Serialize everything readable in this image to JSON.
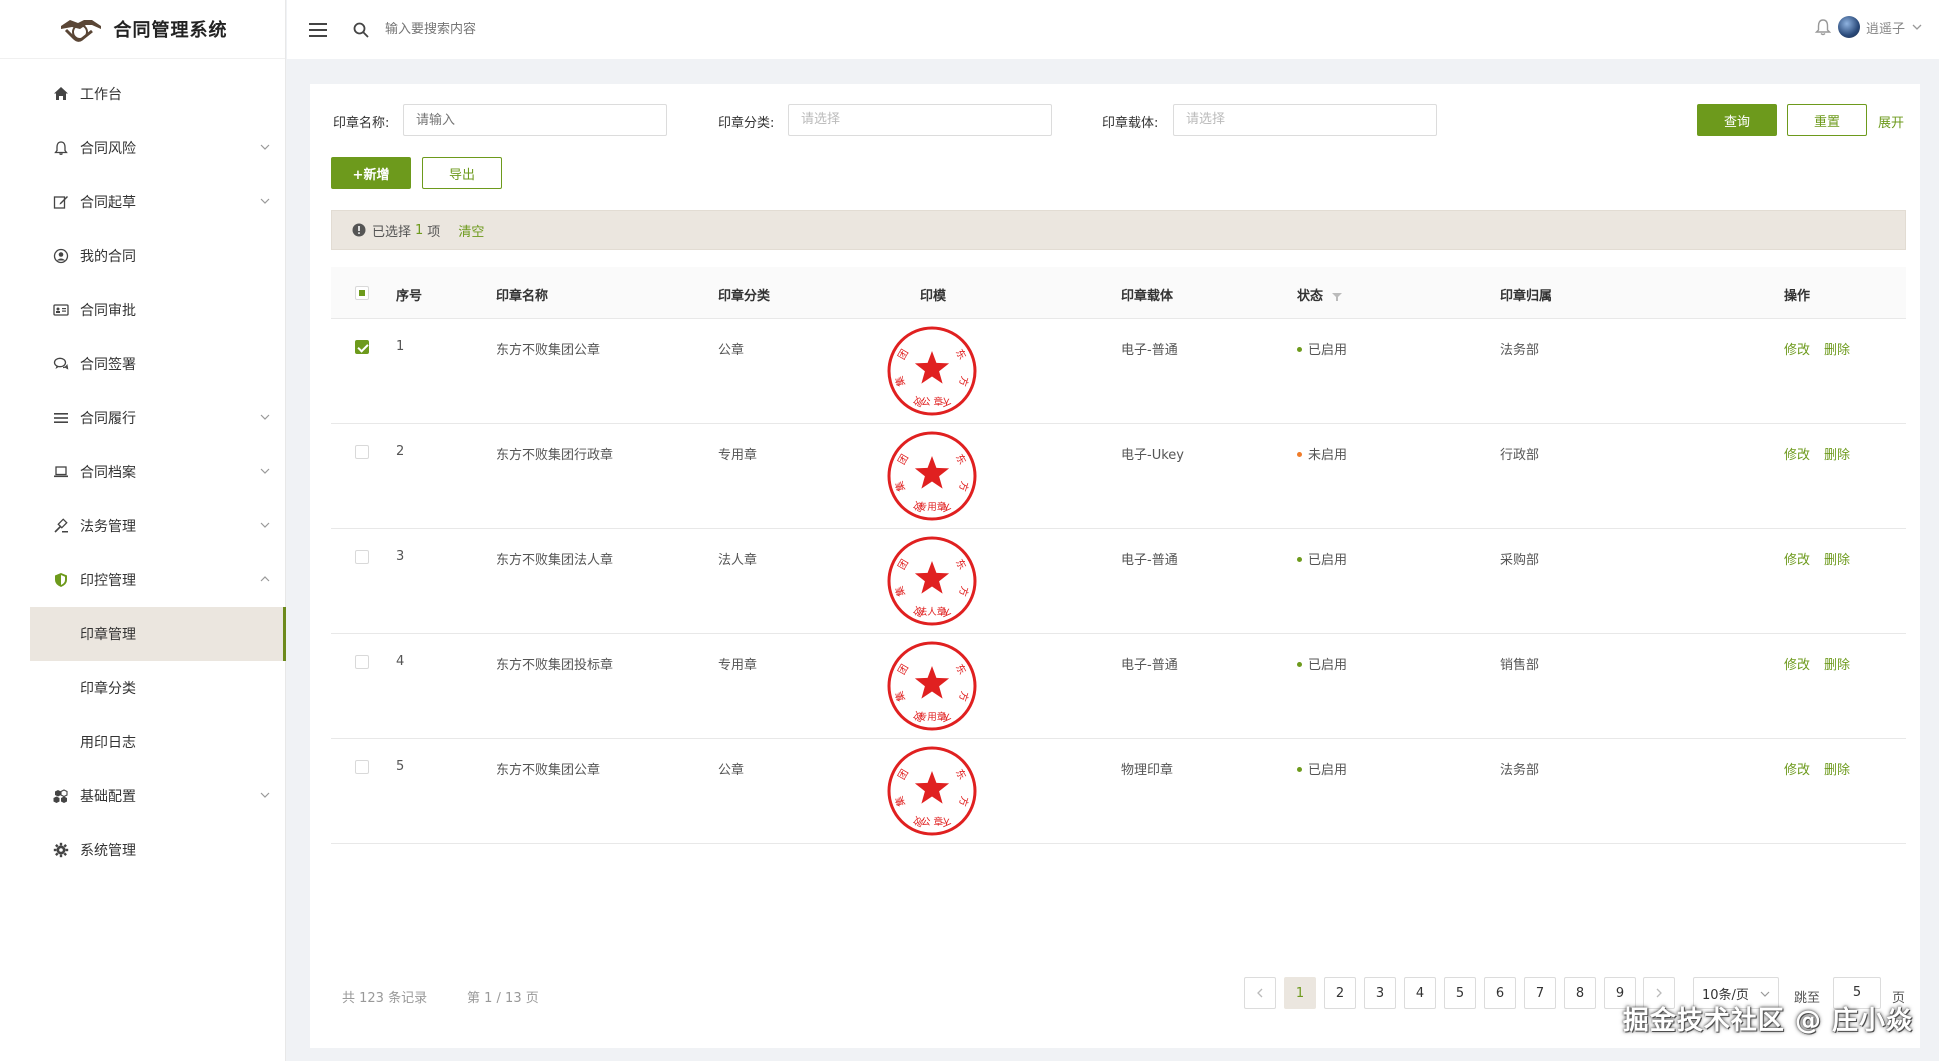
{
  "app": {
    "title": "合同管理系统"
  },
  "header": {
    "search_placeholder": "输入要搜索内容",
    "username": "逍遥子"
  },
  "sidebar": {
    "items": [
      {
        "label": "工作台",
        "icon": "home-icon",
        "expandable": false
      },
      {
        "label": "合同风险",
        "icon": "bell-icon",
        "expandable": true
      },
      {
        "label": "合同起草",
        "icon": "edit-icon",
        "expandable": true
      },
      {
        "label": "我的合同",
        "icon": "user-circle-icon",
        "expandable": false
      },
      {
        "label": "合同审批",
        "icon": "id-card-icon",
        "expandable": false
      },
      {
        "label": "合同签署",
        "icon": "chat-icon",
        "expandable": false
      },
      {
        "label": "合同履行",
        "icon": "list-icon",
        "expandable": true
      },
      {
        "label": "合同档案",
        "icon": "laptop-icon",
        "expandable": true
      },
      {
        "label": "法务管理",
        "icon": "gavel-icon",
        "expandable": true
      },
      {
        "label": "印控管理",
        "icon": "shield-icon",
        "expandable": true,
        "expanded": true
      }
    ],
    "sub_items": [
      "印章管理",
      "印章分类",
      "用印日志"
    ],
    "items_after": [
      {
        "label": "基础配置",
        "icon": "cubes-icon",
        "expandable": true
      },
      {
        "label": "系统管理",
        "icon": "gear-icon",
        "expandable": false
      }
    ]
  },
  "filters": {
    "name_label": "印章名称:",
    "name_placeholder": "请输入",
    "category_label": "印章分类:",
    "category_placeholder": "请选择",
    "carrier_label": "印章载体:",
    "carrier_placeholder": "请选择",
    "query_button": "查询",
    "reset_button": "重置",
    "expand_link": "展开"
  },
  "toolbar": {
    "add_button": "+新增",
    "export_button": "导出"
  },
  "selection": {
    "prefix": "已选择",
    "count": "1",
    "suffix": "项",
    "clear": "清空"
  },
  "table": {
    "headers": {
      "index": "序号",
      "name": "印章名称",
      "category": "印章分类",
      "mold": "印模",
      "carrier": "印章载体",
      "status": "状态",
      "owner": "印章归属",
      "actions": "操作"
    },
    "rows": [
      {
        "index": "1",
        "name": "东方不败集团公章",
        "category": "公章",
        "carrier": "电子-普通",
        "status": "已启用",
        "status_color": "#6d9a1c",
        "owner": "法务部",
        "stamp_text": "公 章",
        "checked": true
      },
      {
        "index": "2",
        "name": "东方不败集团行政章",
        "category": "专用章",
        "carrier": "电子-Ukey",
        "status": "未启用",
        "status_color": "#f07c2a",
        "owner": "行政部",
        "stamp_text": "专用章",
        "checked": false
      },
      {
        "index": "3",
        "name": "东方不败集团法人章",
        "category": "法人章",
        "carrier": "电子-普通",
        "status": "已启用",
        "status_color": "#6d9a1c",
        "owner": "采购部",
        "stamp_text": "法人章",
        "checked": false
      },
      {
        "index": "4",
        "name": "东方不败集团投标章",
        "category": "专用章",
        "carrier": "电子-普通",
        "status": "已启用",
        "status_color": "#6d9a1c",
        "owner": "销售部",
        "stamp_text": "专用章",
        "checked": false
      },
      {
        "index": "5",
        "name": "东方不败集团公章",
        "category": "公章",
        "carrier": "物理印章",
        "status": "已启用",
        "status_color": "#6d9a1c",
        "owner": "法务部",
        "stamp_text": "公 章",
        "checked": false
      }
    ],
    "action_edit": "修改",
    "action_delete": "删除",
    "stamp_ring_chars": "东方不败集团"
  },
  "pagination": {
    "total_text": "共 123 条记录",
    "page_text": "第 1 / 13 页",
    "pages": [
      "1",
      "2",
      "3",
      "4",
      "5",
      "6",
      "7",
      "8",
      "9"
    ],
    "current": "1",
    "page_size": "10条/页",
    "jump_label": "跳至",
    "jump_value": "5",
    "jump_suffix": "页"
  },
  "watermark": "掘金技术社区 @ 庄小焱",
  "colors": {
    "accent": "#6d9a1c",
    "selected_bg": "#ebe6df",
    "stamp_red": "#e02020"
  }
}
